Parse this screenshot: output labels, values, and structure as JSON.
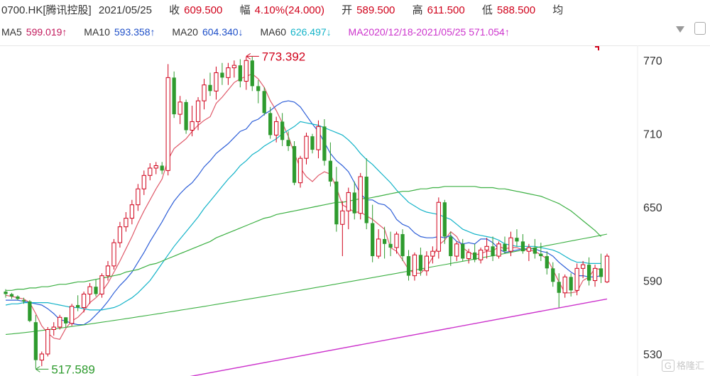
{
  "header": {
    "symbol": "0700.HK[腾讯控股]",
    "date": "2021/05/25",
    "close_label": "收",
    "close_value": "609.500",
    "change_label": "幅",
    "change_value": "4.10%(24.000)",
    "open_label": "开",
    "open_value": "589.500",
    "high_label": "高",
    "high_value": "611.500",
    "low_label": "低",
    "low_value": "588.500",
    "avg_label": "均"
  },
  "indicators": {
    "ma5_label": "MA5",
    "ma5_value": "599.019↑",
    "ma10_label": "MA10",
    "ma10_value": "593.358↑",
    "ma20_label": "MA20",
    "ma20_value": "604.340↓",
    "ma60_label": "MA60",
    "ma60_value": "626.497↓",
    "overlap_text": "MA2020/12/18-2021/05/25 571.054↑"
  },
  "watermark": "格隆汇",
  "colors": {
    "up": "#d0021b",
    "down": "#2e9b2e",
    "ma5": "#e05a6a",
    "ma10": "#2e5fd8",
    "ma20": "#13b3c8",
    "ma60": "#3cb043",
    "ma250": "#cc33cc"
  },
  "chart_data": {
    "type": "candlestick",
    "title": "",
    "x_range": [
      "2020/12/18",
      "2021/05/25"
    ],
    "ylim": [
      512,
      780
    ],
    "yticks": [
      530,
      590,
      650,
      710,
      770
    ],
    "annotations": [
      {
        "label": "773.392",
        "value": 773.392,
        "kind": "high"
      },
      {
        "label": "517.589",
        "value": 517.589,
        "kind": "low"
      }
    ],
    "candles": [
      [
        581,
        583,
        576,
        579
      ],
      [
        579,
        580,
        575,
        577
      ],
      [
        577,
        578,
        574,
        575
      ],
      [
        574,
        576,
        571,
        573
      ],
      [
        573,
        574,
        556,
        557
      ],
      [
        556,
        562,
        518,
        525
      ],
      [
        525,
        532,
        520,
        530
      ],
      [
        530,
        552,
        528,
        550
      ],
      [
        550,
        556,
        545,
        552
      ],
      [
        552,
        562,
        550,
        560
      ],
      [
        560,
        560,
        552,
        555
      ],
      [
        555,
        571,
        553,
        569
      ],
      [
        570,
        578,
        565,
        568
      ],
      [
        568,
        581,
        564,
        579
      ],
      [
        579,
        588,
        571,
        585
      ],
      [
        585,
        591,
        577,
        579
      ],
      [
        579,
        596,
        576,
        594
      ],
      [
        594,
        606,
        590,
        602
      ],
      [
        602,
        624,
        599,
        621
      ],
      [
        621,
        638,
        617,
        634
      ],
      [
        634,
        646,
        630,
        641
      ],
      [
        641,
        656,
        636,
        652
      ],
      [
        652,
        669,
        647,
        665
      ],
      [
        665,
        680,
        660,
        676
      ],
      [
        676,
        686,
        672,
        682
      ],
      [
        682,
        687,
        677,
        684
      ],
      [
        684,
        687,
        677,
        680
      ],
      [
        680,
        767,
        676,
        756
      ],
      [
        756,
        761,
        723,
        726
      ],
      [
        726,
        741,
        718,
        736
      ],
      [
        736,
        738,
        710,
        713
      ],
      [
        713,
        733,
        708,
        720
      ],
      [
        720,
        740,
        713,
        737
      ],
      [
        737,
        755,
        730,
        750
      ],
      [
        750,
        760,
        741,
        745
      ],
      [
        745,
        765,
        738,
        760
      ],
      [
        760,
        768,
        750,
        756
      ],
      [
        756,
        768,
        750,
        764
      ],
      [
        764,
        770,
        756,
        766
      ],
      [
        766,
        771,
        748,
        753
      ],
      [
        753,
        773,
        746,
        770
      ],
      [
        770,
        773,
        745,
        749
      ],
      [
        749,
        754,
        735,
        745
      ],
      [
        745,
        748,
        725,
        727
      ],
      [
        727,
        732,
        706,
        709
      ],
      [
        709,
        724,
        703,
        720
      ],
      [
        720,
        727,
        700,
        705
      ],
      [
        705,
        712,
        696,
        700
      ],
      [
        700,
        704,
        668,
        670
      ],
      [
        670,
        692,
        666,
        690
      ],
      [
        690,
        711,
        685,
        708
      ],
      [
        708,
        710,
        694,
        697
      ],
      [
        697,
        721,
        690,
        716
      ],
      [
        716,
        722,
        684,
        688
      ],
      [
        688,
        703,
        667,
        671
      ],
      [
        671,
        683,
        630,
        636
      ],
      [
        636,
        655,
        610,
        647
      ],
      [
        647,
        666,
        632,
        662
      ],
      [
        662,
        671,
        640,
        645
      ],
      [
        645,
        678,
        640,
        675
      ],
      [
        675,
        690,
        632,
        637
      ],
      [
        637,
        652,
        605,
        610
      ],
      [
        610,
        632,
        608,
        624
      ],
      [
        624,
        634,
        608,
        620
      ],
      [
        620,
        630,
        610,
        617
      ],
      [
        617,
        630,
        612,
        628
      ],
      [
        628,
        632,
        606,
        610
      ],
      [
        610,
        615,
        590,
        594
      ],
      [
        594,
        613,
        590,
        611
      ],
      [
        611,
        617,
        594,
        598
      ],
      [
        598,
        614,
        594,
        610
      ],
      [
        610,
        618,
        604,
        614
      ],
      [
        614,
        658,
        608,
        654
      ],
      [
        654,
        656,
        620,
        626
      ],
      [
        626,
        630,
        602,
        610
      ],
      [
        610,
        622,
        606,
        620
      ],
      [
        620,
        624,
        606,
        608
      ],
      [
        608,
        616,
        604,
        613
      ],
      [
        613,
        620,
        605,
        607
      ],
      [
        607,
        617,
        604,
        615
      ],
      [
        615,
        625,
        608,
        618
      ],
      [
        618,
        626,
        606,
        610
      ],
      [
        610,
        622,
        608,
        620
      ],
      [
        620,
        626,
        612,
        614
      ],
      [
        614,
        630,
        610,
        625
      ],
      [
        625,
        632,
        618,
        622
      ],
      [
        622,
        628,
        612,
        614
      ],
      [
        614,
        620,
        606,
        617
      ],
      [
        617,
        624,
        608,
        612
      ],
      [
        612,
        621,
        606,
        610
      ],
      [
        610,
        614,
        595,
        600
      ],
      [
        600,
        605,
        585,
        589
      ],
      [
        589,
        596,
        568,
        580
      ],
      [
        580,
        595,
        576,
        593
      ],
      [
        593,
        596,
        577,
        582
      ],
      [
        582,
        604,
        578,
        600
      ],
      [
        600,
        606,
        592,
        603
      ],
      [
        603,
        609,
        586,
        590
      ],
      [
        590,
        603,
        585,
        600
      ],
      [
        600,
        612,
        588,
        593
      ],
      [
        589,
        612,
        588,
        610
      ]
    ],
    "series": [
      {
        "name": "MA5",
        "values": [
          578,
          577,
          576,
          575,
          572,
          563,
          553,
          547,
          543,
          542,
          551,
          557,
          560,
          565,
          572,
          576,
          581,
          588,
          597,
          606,
          616,
          626,
          637,
          647,
          656,
          665,
          673,
          689,
          698,
          702,
          706,
          712,
          717,
          721,
          724,
          735,
          740,
          746,
          752,
          755,
          757,
          759,
          755,
          748,
          737,
          729,
          719,
          708,
          694,
          682,
          675,
          671,
          676,
          679,
          677,
          666,
          652,
          649,
          646,
          646,
          643,
          640,
          636,
          632,
          617,
          614,
          607,
          599,
          596,
          596,
          601,
          609,
          619,
          623,
          630,
          626,
          617,
          613,
          611,
          612,
          614,
          614,
          618,
          616,
          617,
          617,
          615,
          615,
          614,
          611,
          608,
          599,
          589,
          580,
          580,
          581,
          590,
          593,
          600,
          599
        ]
      },
      {
        "name": "MA10",
        "values": [
          574,
          574,
          574,
          573,
          572,
          571,
          570,
          567,
          563,
          558,
          557,
          555,
          554,
          554,
          557,
          562,
          567,
          573,
          580,
          586,
          591,
          597,
          605,
          613,
          622,
          630,
          638,
          647,
          655,
          661,
          666,
          670,
          676,
          683,
          688,
          694,
          698,
          702,
          707,
          712,
          714,
          720,
          722,
          726,
          729,
          733,
          736,
          737,
          736,
          732,
          725,
          718,
          712,
          703,
          694,
          688,
          684,
          679,
          670,
          661,
          656,
          656,
          653,
          652,
          648,
          640,
          636,
          634,
          629,
          626,
          625,
          625,
          626,
          625,
          627,
          622,
          620,
          621,
          620,
          624,
          624,
          621,
          616,
          613,
          614,
          615,
          616,
          616,
          616,
          614,
          613,
          610,
          605,
          601,
          597,
          594,
          594,
          593,
          593,
          594
        ]
      },
      {
        "name": "MA20",
        "values": [
          570,
          571,
          571,
          572,
          572,
          572,
          572,
          572,
          571,
          570,
          569,
          568,
          568,
          567,
          566,
          566,
          566,
          567,
          568,
          570,
          573,
          576,
          580,
          585,
          590,
          597,
          604,
          611,
          618,
          624,
          630,
          636,
          642,
          649,
          655,
          661,
          667,
          673,
          678,
          684,
          688,
          693,
          696,
          700,
          703,
          706,
          710,
          713,
          716,
          720,
          719,
          718,
          717,
          715,
          713,
          711,
          709,
          705,
          700,
          694,
          689,
          685,
          680,
          675,
          670,
          664,
          659,
          654,
          651,
          648,
          646,
          645,
          644,
          642,
          640,
          636,
          632,
          630,
          628,
          627,
          626,
          625,
          623,
          620,
          619,
          618,
          618,
          618,
          618,
          617,
          616,
          615,
          613,
          610,
          607,
          605,
          605,
          604,
          604,
          604
        ]
      },
      {
        "name": "MA60",
        "values": [
          582,
          582,
          583,
          583,
          584,
          584,
          585,
          585,
          586,
          587,
          587,
          588,
          589,
          589,
          590,
          591,
          592,
          593,
          594,
          595,
          597,
          598,
          599,
          601,
          603,
          604,
          606,
          608,
          610,
          612,
          614,
          616,
          618,
          620,
          622,
          625,
          627,
          629,
          631,
          633,
          635,
          637,
          639,
          641,
          642,
          644,
          645,
          646,
          647,
          648,
          649,
          650,
          651,
          652,
          653,
          654,
          654,
          655,
          656,
          657,
          657,
          658,
          659,
          660,
          661,
          662,
          663,
          663,
          664,
          665,
          665,
          666,
          666,
          667,
          667,
          667,
          667,
          667,
          667,
          666,
          666,
          666,
          665,
          665,
          664,
          663,
          662,
          661,
          660,
          659,
          657,
          655,
          653,
          650,
          647,
          643,
          639,
          635,
          631,
          626
        ]
      },
      {
        "name": "MA250",
        "values": [
          546,
          547,
          547,
          548,
          548,
          549,
          550,
          550,
          551,
          552,
          553,
          554,
          555,
          556,
          557,
          558,
          559,
          560,
          561,
          562,
          563,
          565,
          566,
          567,
          568,
          570,
          571,
          572,
          574,
          575,
          577,
          578,
          580,
          581,
          583,
          584,
          585,
          587,
          588,
          589,
          591,
          592,
          593,
          594,
          595,
          596,
          597,
          598,
          599,
          600,
          601,
          601,
          602,
          603,
          603,
          604,
          604,
          605,
          605,
          606,
          606,
          607,
          607,
          608,
          608,
          609,
          609,
          610,
          610,
          611,
          611,
          612,
          612,
          613,
          613,
          614,
          614,
          615,
          615,
          616,
          616,
          617,
          617,
          618,
          618,
          619,
          619,
          620,
          620,
          621,
          621,
          622,
          622,
          623,
          623,
          624,
          624,
          625,
          625,
          626
        ]
      },
      {
        "name": "MA_lower",
        "values": [
          null,
          null,
          null,
          null,
          null,
          null,
          null,
          null,
          null,
          null,
          null,
          null,
          null,
          null,
          null,
          null,
          null,
          null,
          null,
          null,
          null,
          null,
          null,
          null,
          null,
          null,
          null,
          null,
          null,
          null,
          null,
          null,
          null,
          null,
          null,
          null,
          null,
          null,
          null,
          null,
          null,
          null,
          null,
          null,
          null,
          null,
          null,
          null,
          null,
          null,
          null,
          null,
          null,
          null,
          null,
          null,
          null,
          null,
          null,
          null,
          null,
          null,
          null,
          null,
          null,
          null,
          null,
          null,
          null,
          null,
          null,
          null,
          null,
          null,
          null,
          null,
          null,
          null,
          null,
          null,
          null,
          null,
          null,
          null,
          null,
          null,
          null,
          null,
          null,
          null,
          null,
          null,
          null,
          null,
          null,
          null,
          null,
          null,
          null,
          null
        ]
      }
    ],
    "ma250_extra": {
      "start": 511,
      "end": 575
    }
  }
}
